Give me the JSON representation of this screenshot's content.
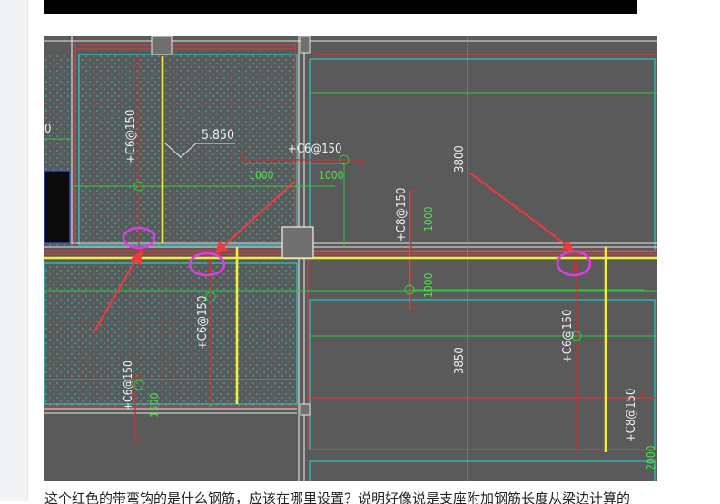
{
  "drawing": {
    "labels": {
      "elev": "5.850",
      "r_a": "+C6@150",
      "r_b": "+C6@150",
      "r_c": "+C6@150",
      "r_d": "+C6@150",
      "r_e": "+C8@150",
      "r_f": "+C6@150",
      "r_g": "+C8@150",
      "d1": "1000",
      "d2": "1000",
      "d3": "1000",
      "d4": "1000",
      "d5": "3800",
      "d6": "3850",
      "d7": "1500",
      "d8": "2000",
      "frag": "0"
    },
    "marks": {
      "m1": "1",
      "m2": "1"
    }
  },
  "caption": "这个红色的带弯钩的是什么钢筋，应该在哪里设置？说明好像说是支座附加钢筋长度从梁边计算的"
}
